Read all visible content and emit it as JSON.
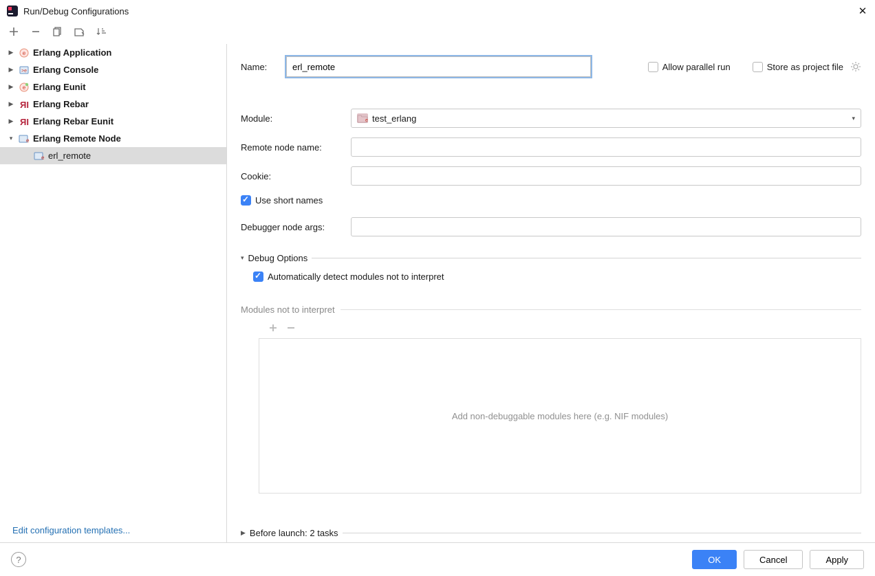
{
  "window": {
    "title": "Run/Debug Configurations"
  },
  "toolbar": {
    "add": "+",
    "remove": "−"
  },
  "tree": {
    "items": [
      {
        "label": "Erlang Application",
        "expanded": false,
        "icon": "erlang-app"
      },
      {
        "label": "Erlang Console",
        "expanded": false,
        "icon": "erlang-console"
      },
      {
        "label": "Erlang Eunit",
        "expanded": false,
        "icon": "erlang-eunit"
      },
      {
        "label": "Erlang Rebar",
        "expanded": false,
        "icon": "rebar"
      },
      {
        "label": "Erlang Rebar Eunit",
        "expanded": false,
        "icon": "rebar"
      },
      {
        "label": "Erlang Remote Node",
        "expanded": true,
        "icon": "remote-node",
        "children": [
          {
            "label": "erl_remote",
            "selected": true
          }
        ]
      }
    ]
  },
  "edit_templates": "Edit configuration templates...",
  "form": {
    "name_label": "Name:",
    "name_value": "erl_remote",
    "allow_parallel_label": "Allow parallel run",
    "allow_parallel_checked": false,
    "store_as_project_label": "Store as project file",
    "store_as_project_checked": false,
    "module_label": "Module:",
    "module_value": "test_erlang",
    "remote_node_label": "Remote node name:",
    "remote_node_value": "",
    "cookie_label": "Cookie:",
    "cookie_value": "",
    "use_short_names_label": "Use short names",
    "use_short_names_checked": true,
    "debugger_args_label": "Debugger node args:",
    "debugger_args_value": "",
    "debug_options_label": "Debug Options",
    "auto_detect_label": "Automatically detect modules not to interpret",
    "auto_detect_checked": true,
    "modules_not_interpret_label": "Modules not to interpret",
    "drop_placeholder": "Add non-debuggable modules here (e.g. NIF modules)",
    "before_launch_label": "Before launch: 2 tasks"
  },
  "footer": {
    "ok": "OK",
    "cancel": "Cancel",
    "apply": "Apply"
  }
}
